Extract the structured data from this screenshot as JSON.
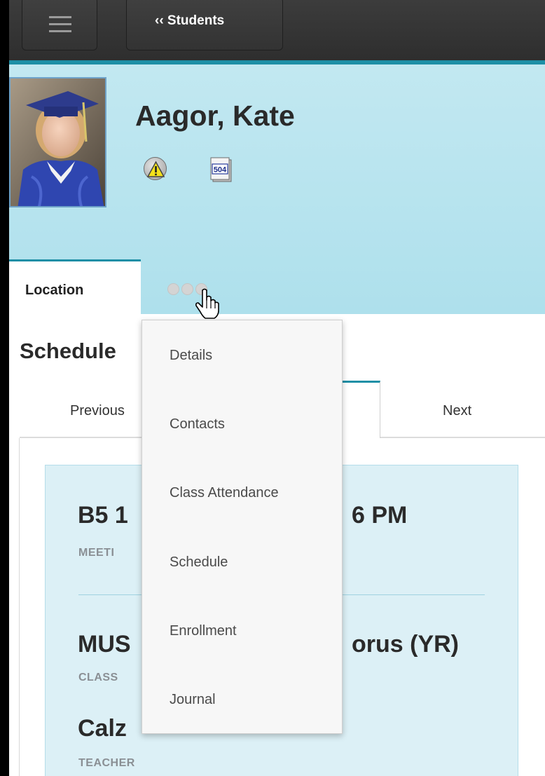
{
  "toolbar": {
    "back_label": "‹‹ Students"
  },
  "student": {
    "name": "Aagor, Kate",
    "badge_504": "504"
  },
  "tabs": {
    "active_label": "Location"
  },
  "section": {
    "title": "Schedule"
  },
  "nav": {
    "previous_label": "Previous",
    "next_label": "Next"
  },
  "card": {
    "meeting_value": "B5 1",
    "meeting_value_tail": "6 PM",
    "meeting_label": "MEETI",
    "class_value": "MUS",
    "class_value_tail": "orus (YR)",
    "class_label": "CLASS",
    "teacher_value": "Calz",
    "teacher_label": "TEACHER"
  },
  "dropdown": {
    "items": [
      {
        "label": "Details"
      },
      {
        "label": "Contacts"
      },
      {
        "label": "Class Attendance"
      },
      {
        "label": "Schedule"
      },
      {
        "label": "Enrollment"
      },
      {
        "label": "Journal"
      }
    ]
  },
  "colors": {
    "accent": "#1e8fa6",
    "header_bg": "#b9e4ef",
    "card_bg": "#dcf0f6"
  },
  "icons": {
    "menu": "hamburger-icon",
    "alert": "warning-icon",
    "doc": "504-document-icon",
    "more": "more-dots-icon",
    "cursor": "hand-pointer-icon"
  }
}
